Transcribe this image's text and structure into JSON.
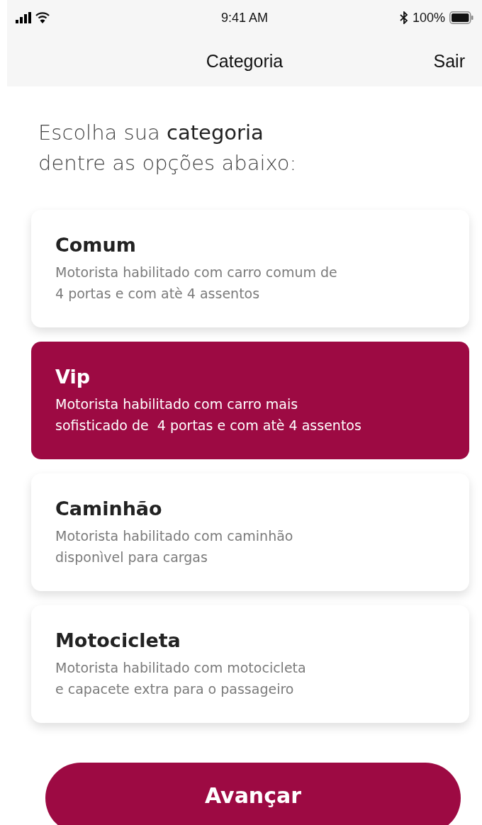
{
  "status_bar": {
    "time": "9:41 AM",
    "battery": "100%"
  },
  "nav": {
    "title": "Categoria",
    "action": "Sair"
  },
  "heading": "Escolha sua **categoria**\ndentre as opções abaixo:",
  "categories": [
    {
      "title": "Comum",
      "description": "Motorista habilitado com carro comum de\n4 portas e com atè 4 assentos",
      "selected": false
    },
    {
      "title": "Vip",
      "description": "Motorista habilitado com carro mais\nsofisticado de  4 portas e com atè 4 assentos",
      "selected": true
    },
    {
      "title": "Caminhão",
      "description": "Motorista habilitado com caminhão\ndisponìvel para cargas",
      "selected": false
    },
    {
      "title": "Motocicleta",
      "description": "Motorista habilitado com motocicleta\ne capacete extra para o passageiro",
      "selected": false
    }
  ],
  "button": "Avançar"
}
